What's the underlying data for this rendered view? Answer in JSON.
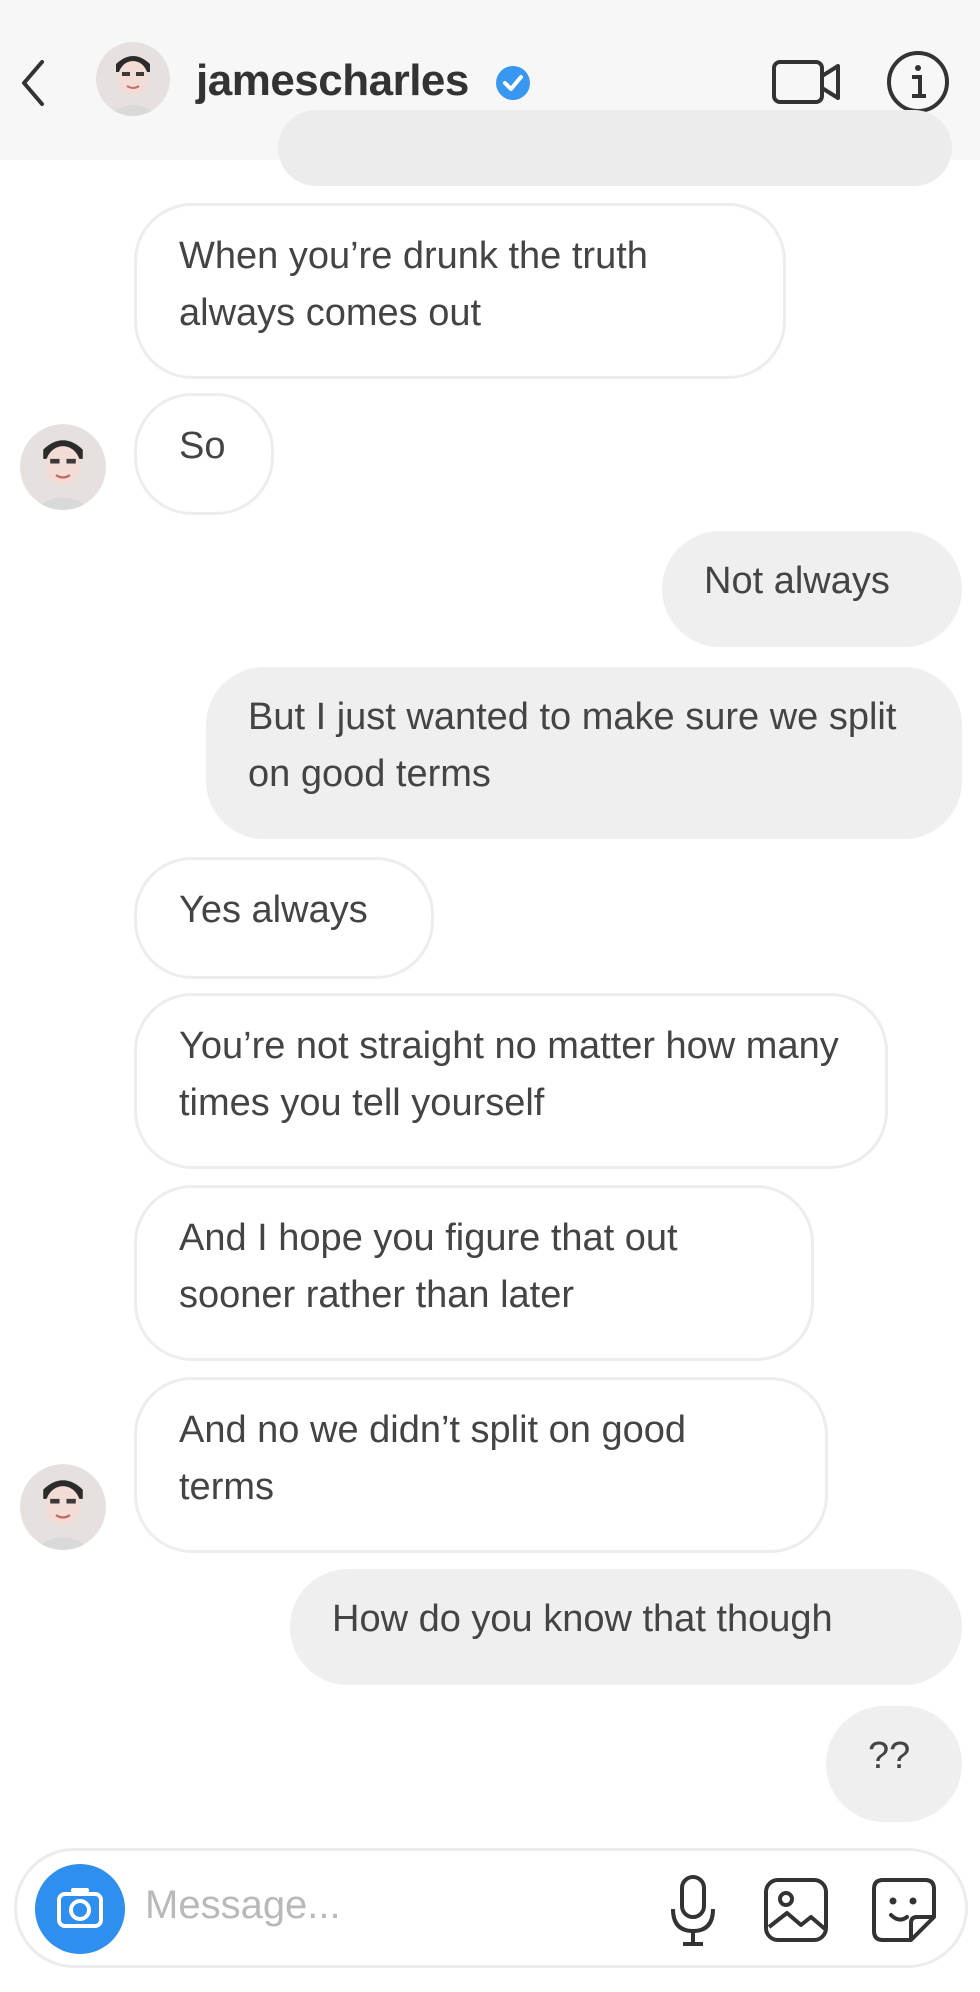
{
  "header": {
    "username": "jamescharles",
    "icons": [
      "back-chevron-icon",
      "avatar",
      "verified-badge-icon",
      "video-call-icon",
      "info-icon"
    ],
    "accent": "#3897f0"
  },
  "messages": [
    {
      "side": "received",
      "text": "When you’re drunk the truth always comes out"
    },
    {
      "side": "received",
      "text": "So"
    },
    {
      "side": "sent",
      "text": "Not always"
    },
    {
      "side": "sent",
      "text": "But I just wanted to make sure we split on good terms"
    },
    {
      "side": "received",
      "text": "Yes always"
    },
    {
      "side": "received",
      "text": "You’re not straight no matter how many times you tell yourself"
    },
    {
      "side": "received",
      "text": "And I hope you figure that out sooner rather than later"
    },
    {
      "side": "received",
      "text": "And no we didn’t split on good terms"
    },
    {
      "side": "sent",
      "text": "How do you know that though"
    },
    {
      "side": "sent",
      "text": "??"
    }
  ],
  "composer": {
    "placeholder": "Message...",
    "icons": [
      "camera-icon",
      "microphone-icon",
      "gallery-icon",
      "sticker-icon"
    ]
  }
}
